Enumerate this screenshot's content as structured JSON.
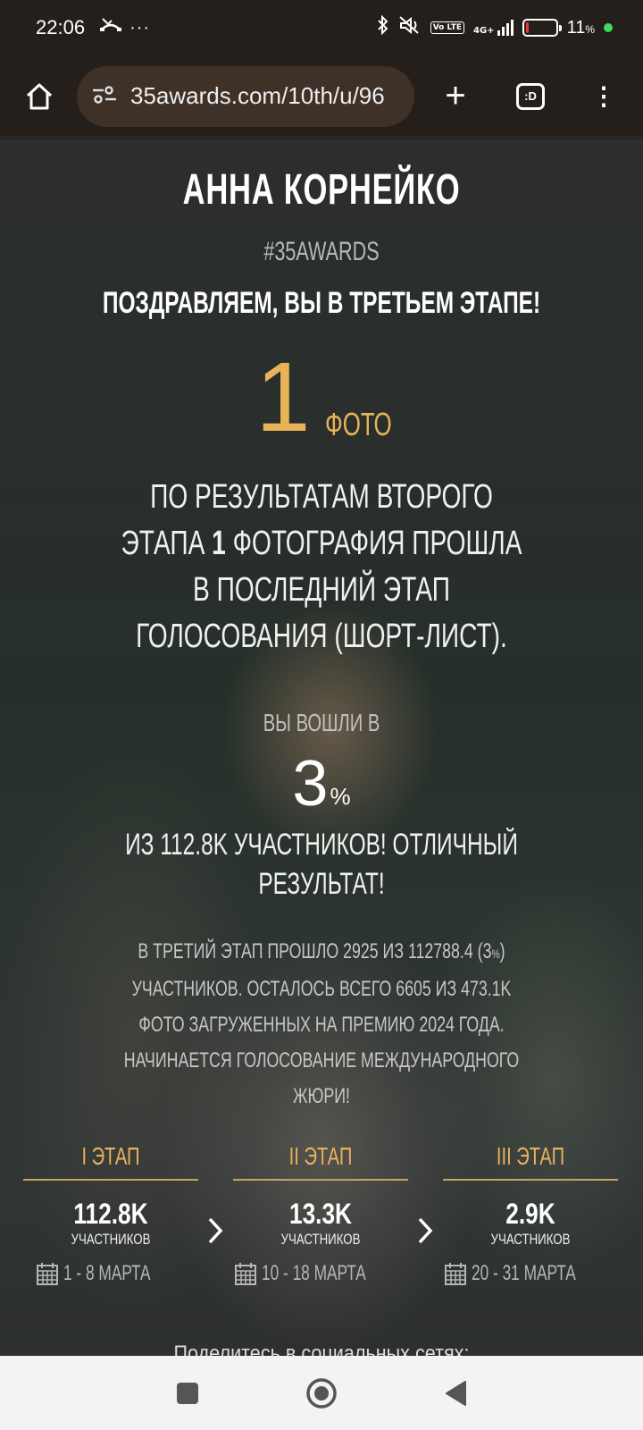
{
  "status_bar": {
    "time": "22:06",
    "missed_call_icon": "missed-call-icon",
    "more_dots": "···",
    "volte": "Vo LTE",
    "network": "4G+",
    "battery_percent": "11",
    "battery_unit": "%",
    "battery_level": 0.11,
    "battery_color": "#e33333",
    "indicator_color": "#3ddc5a"
  },
  "browser": {
    "url": "35awards.com/10th/u/96",
    "tabs_label": ":D",
    "plus_label": "+",
    "menu_label": "⋮"
  },
  "page": {
    "name": "АННА КОРНЕЙКО",
    "hashtag": "#35AWARDS",
    "congrats": "ПОЗДРАВЛЯЕМ, ВЫ В ТРЕТЬЕМ ЭТАПЕ!",
    "photo_count": "1",
    "photo_unit": "ФОТО",
    "result_before": "ПО РЕЗУЛЬТАТАМ ВТОРОГО ЭТАПА ",
    "result_count": "1",
    "result_after": " ФОТОГРАФИЯ ПРОШЛА В ПОСЛЕДНИЙ ЭТАП ГОЛОСОВАНИЯ (ШОРТ-ЛИСТ).",
    "entered_label": "ВЫ ВОШЛИ В",
    "percent_value": "3",
    "percent_sign": "%",
    "of_total": "ИЗ 112.8K УЧАСТНИКОВ! ОТЛИЧНЫЙ РЕЗУЛЬТАТ!",
    "details_a": "В ТРЕТИЙ ЭТАП ПРОШЛО 2925 ИЗ 112788.4 (3",
    "details_pct": "%",
    "details_b": ") УЧАСТНИКОВ. ОСТАЛОСЬ ВСЕГО 6605 ИЗ 473.1K ФОТО ЗАГРУЖЕННЫХ НА ПРЕМИЮ 2024 ГОДА. НАЧИНАЕТСЯ ГОЛОСОВАНИЕ МЕЖДУНАРОДНОГО ЖЮРИ!",
    "accent_color": "#e8b458",
    "share_text": "Поделитесь в социальных сетях:"
  },
  "stages": [
    {
      "title": "I ЭТАП",
      "value": "112.8K",
      "caption": "УЧАСТНИКОВ",
      "dates": "1 - 8 МАРТА"
    },
    {
      "title": "II ЭТАП",
      "value": "13.3K",
      "caption": "УЧАСТНИКОВ",
      "dates": "10 - 18 МАРТА"
    },
    {
      "title": "III ЭТАП",
      "value": "2.9K",
      "caption": "УЧАСТНИКОВ",
      "dates": "20 - 31 МАРТА"
    }
  ],
  "nav": {
    "recents_icon": "square-icon",
    "home_icon": "circle-icon",
    "back_icon": "triangle-back-icon"
  }
}
